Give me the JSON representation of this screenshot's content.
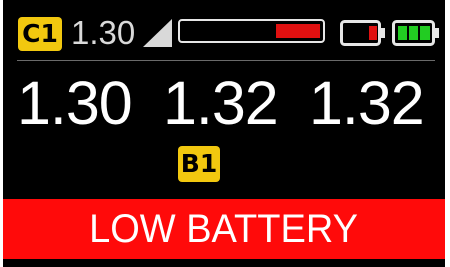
{
  "status_bar": {
    "channel": "C1",
    "current_value": "1.30",
    "level_fraction": 0.32,
    "colors": {
      "badge": "#f2c80f",
      "level": "#e01010",
      "battery_low": "#e01010",
      "battery_full": "#22cc22"
    },
    "icons": [
      "signal-strength-icon",
      "battery-low-icon",
      "battery-full-icon"
    ]
  },
  "readings": [
    "1.30",
    "1.32",
    "1.32"
  ],
  "bank": "B1",
  "alert": {
    "text": "LOW BATTERY",
    "color": "#ff0a0a"
  }
}
